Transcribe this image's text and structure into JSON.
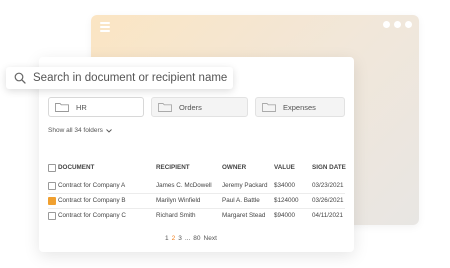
{
  "search": {
    "placeholder": "Search in document or recipient name"
  },
  "folders": [
    {
      "label": "HR"
    },
    {
      "label": "Orders"
    },
    {
      "label": "Expenses"
    }
  ],
  "show_all": "Show all 34 folders",
  "table": {
    "headers": [
      "DOCUMENT",
      "RECIPIENT",
      "OWNER",
      "VALUE",
      "SIGN DATE"
    ],
    "rows": [
      {
        "checked": false,
        "document": "Contract for Company A",
        "recipient": "James C. McDowell",
        "owner": "Jeremy Packard",
        "value": "$34000",
        "sign_date": "03/23/2021"
      },
      {
        "checked": true,
        "document": "Contract for Company B",
        "recipient": "Marilyn Winfield",
        "owner": "Paul A. Battle",
        "value": "$124000",
        "sign_date": "03/26/2021"
      },
      {
        "checked": false,
        "document": "Contract for Company C",
        "recipient": "Richard Smith",
        "owner": "Margaret Stead",
        "value": "$94000",
        "sign_date": "04/11/2021"
      }
    ]
  },
  "pagination": {
    "pages": [
      "1",
      "2",
      "3"
    ],
    "ellipsis": "...",
    "last": "80",
    "next": "Next",
    "active": "2"
  },
  "colors": {
    "accent": "#f08020",
    "checkbox_checked": "#f0a030"
  }
}
